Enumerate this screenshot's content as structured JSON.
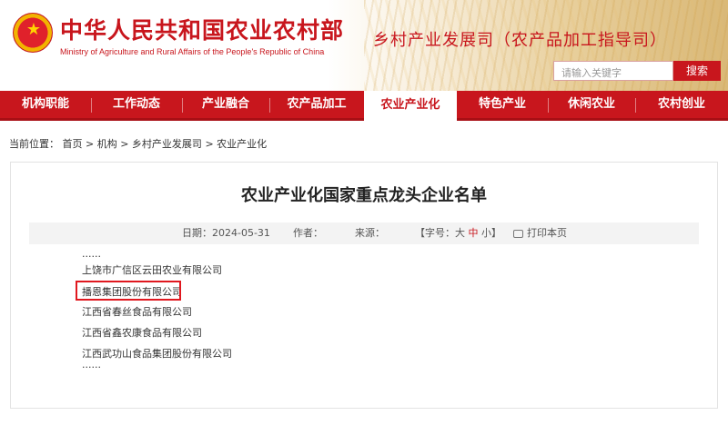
{
  "header": {
    "title_cn": "中华人民共和国农业农村部",
    "title_en": "Ministry of Agriculture and Rural Affairs of the People's Republic of China",
    "department": "乡村产业发展司（农产品加工指导司）",
    "search_placeholder": "请输入关键字",
    "search_button": "搜索"
  },
  "nav": {
    "items": [
      {
        "label": "机构职能"
      },
      {
        "label": "工作动态"
      },
      {
        "label": "产业融合"
      },
      {
        "label": "农产品加工"
      },
      {
        "label": "农业产业化"
      },
      {
        "label": "特色产业"
      },
      {
        "label": "休闲农业"
      },
      {
        "label": "农村创业"
      }
    ],
    "active": "农业产业化"
  },
  "breadcrumb": {
    "prefix": "当前位置：",
    "items": [
      "首页",
      "机构",
      "乡村产业发展司",
      "农业产业化"
    ],
    "separator": ">"
  },
  "article": {
    "title": "农业产业化国家重点龙头企业名单",
    "date_label": "日期：",
    "date": "2024-05-31",
    "author_label": "作者：",
    "source_label": "来源：",
    "font_label": "【字号：",
    "font_large": "大",
    "font_medium": "中",
    "font_small": "小",
    "font_close": "】",
    "print_label": "打印本页",
    "lines": [
      "······",
      "上饶市广信区云田农业有限公司",
      "播恩集团股份有限公司",
      "江西省春丝食品有限公司",
      "江西省鑫农康食品有限公司",
      "江西武功山食品集团股份有限公司",
      "······"
    ]
  },
  "colors": {
    "brand_red": "#c8161d",
    "highlight_border": "#e0181f"
  },
  "icons": {
    "emblem": "national-emblem-icon",
    "print": "printer-icon"
  }
}
